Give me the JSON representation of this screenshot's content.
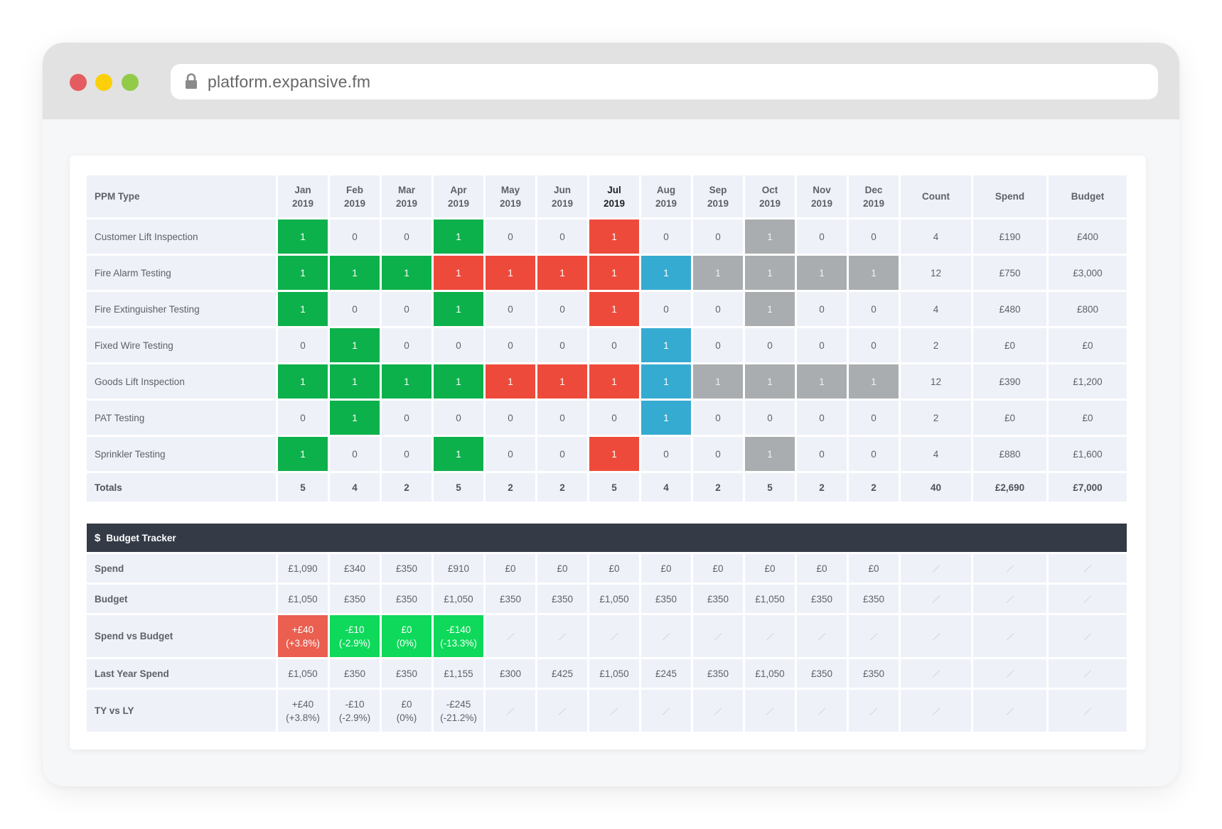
{
  "browser": {
    "url": "platform.expansive.fm",
    "lock_icon": "lock-icon",
    "window_controls": [
      "close",
      "minimize",
      "maximize"
    ]
  },
  "colors": {
    "completed": "#0db14b",
    "overdue": "#ee4a3b",
    "current": "#36abd1",
    "scheduled": "#a9adaf",
    "over_budget": "#ea5f50",
    "under_budget": "#0ed95a",
    "tracker_header": "#343a46"
  },
  "ppm": {
    "headers": {
      "type": "PPM Type",
      "months": [
        {
          "m": "Jan",
          "y": "2019"
        },
        {
          "m": "Feb",
          "y": "2019"
        },
        {
          "m": "Mar",
          "y": "2019"
        },
        {
          "m": "Apr",
          "y": "2019"
        },
        {
          "m": "May",
          "y": "2019"
        },
        {
          "m": "Jun",
          "y": "2019"
        },
        {
          "m": "Jul",
          "y": "2019",
          "current": true
        },
        {
          "m": "Aug",
          "y": "2019"
        },
        {
          "m": "Sep",
          "y": "2019"
        },
        {
          "m": "Oct",
          "y": "2019"
        },
        {
          "m": "Nov",
          "y": "2019"
        },
        {
          "m": "Dec",
          "y": "2019"
        }
      ],
      "count": "Count",
      "spend": "Spend",
      "budget": "Budget"
    },
    "rows": [
      {
        "name": "Customer Lift Inspection",
        "cells": [
          [
            "1",
            "g"
          ],
          [
            "0",
            ""
          ],
          [
            "0",
            ""
          ],
          [
            "1",
            "g"
          ],
          [
            "0",
            ""
          ],
          [
            "0",
            ""
          ],
          [
            "1",
            "r"
          ],
          [
            "0",
            ""
          ],
          [
            "0",
            ""
          ],
          [
            "1",
            "k"
          ],
          [
            "0",
            ""
          ],
          [
            "0",
            ""
          ]
        ],
        "count": "4",
        "spend": "£190",
        "budget": "£400"
      },
      {
        "name": "Fire Alarm Testing",
        "cells": [
          [
            "1",
            "g"
          ],
          [
            "1",
            "g"
          ],
          [
            "1",
            "g"
          ],
          [
            "1",
            "r"
          ],
          [
            "1",
            "r"
          ],
          [
            "1",
            "r"
          ],
          [
            "1",
            "r"
          ],
          [
            "1",
            "b"
          ],
          [
            "1",
            "k"
          ],
          [
            "1",
            "k"
          ],
          [
            "1",
            "k"
          ],
          [
            "1",
            "k"
          ]
        ],
        "count": "12",
        "spend": "£750",
        "budget": "£3,000"
      },
      {
        "name": "Fire Extinguisher Testing",
        "cells": [
          [
            "1",
            "g"
          ],
          [
            "0",
            ""
          ],
          [
            "0",
            ""
          ],
          [
            "1",
            "g"
          ],
          [
            "0",
            ""
          ],
          [
            "0",
            ""
          ],
          [
            "1",
            "r"
          ],
          [
            "0",
            ""
          ],
          [
            "0",
            ""
          ],
          [
            "1",
            "k"
          ],
          [
            "0",
            ""
          ],
          [
            "0",
            ""
          ]
        ],
        "count": "4",
        "spend": "£480",
        "budget": "£800"
      },
      {
        "name": "Fixed Wire Testing",
        "cells": [
          [
            "0",
            ""
          ],
          [
            "1",
            "g"
          ],
          [
            "0",
            ""
          ],
          [
            "0",
            ""
          ],
          [
            "0",
            ""
          ],
          [
            "0",
            ""
          ],
          [
            "0",
            ""
          ],
          [
            "1",
            "b"
          ],
          [
            "0",
            ""
          ],
          [
            "0",
            ""
          ],
          [
            "0",
            ""
          ],
          [
            "0",
            ""
          ]
        ],
        "count": "2",
        "spend": "£0",
        "budget": "£0"
      },
      {
        "name": "Goods Lift Inspection",
        "cells": [
          [
            "1",
            "g"
          ],
          [
            "1",
            "g"
          ],
          [
            "1",
            "g"
          ],
          [
            "1",
            "g"
          ],
          [
            "1",
            "r"
          ],
          [
            "1",
            "r"
          ],
          [
            "1",
            "r"
          ],
          [
            "1",
            "b"
          ],
          [
            "1",
            "k"
          ],
          [
            "1",
            "k"
          ],
          [
            "1",
            "k"
          ],
          [
            "1",
            "k"
          ]
        ],
        "count": "12",
        "spend": "£390",
        "budget": "£1,200"
      },
      {
        "name": "PAT Testing",
        "cells": [
          [
            "0",
            ""
          ],
          [
            "1",
            "g"
          ],
          [
            "0",
            ""
          ],
          [
            "0",
            ""
          ],
          [
            "0",
            ""
          ],
          [
            "0",
            ""
          ],
          [
            "0",
            ""
          ],
          [
            "1",
            "b"
          ],
          [
            "0",
            ""
          ],
          [
            "0",
            ""
          ],
          [
            "0",
            ""
          ],
          [
            "0",
            ""
          ]
        ],
        "count": "2",
        "spend": "£0",
        "budget": "£0"
      },
      {
        "name": "Sprinkler Testing",
        "cells": [
          [
            "1",
            "g"
          ],
          [
            "0",
            ""
          ],
          [
            "0",
            ""
          ],
          [
            "1",
            "g"
          ],
          [
            "0",
            ""
          ],
          [
            "0",
            ""
          ],
          [
            "1",
            "r"
          ],
          [
            "0",
            ""
          ],
          [
            "0",
            ""
          ],
          [
            "1",
            "k"
          ],
          [
            "0",
            ""
          ],
          [
            "0",
            ""
          ]
        ],
        "count": "4",
        "spend": "£880",
        "budget": "£1,600"
      }
    ],
    "totals": {
      "label": "Totals",
      "months": [
        "5",
        "4",
        "2",
        "5",
        "2",
        "2",
        "5",
        "4",
        "2",
        "5",
        "2",
        "2"
      ],
      "count": "40",
      "spend": "£2,690",
      "budget": "£7,000"
    }
  },
  "budget_tracker": {
    "title": "Budget Tracker",
    "icon": "dollar-icon",
    "rows": [
      {
        "label": "Spend",
        "tall": false,
        "cells": [
          [
            "£1,090",
            ""
          ],
          [
            "£340",
            ""
          ],
          [
            "£350",
            ""
          ],
          [
            "£910",
            ""
          ],
          [
            "£0",
            ""
          ],
          [
            "£0",
            ""
          ],
          [
            "£0",
            ""
          ],
          [
            "£0",
            ""
          ],
          [
            "£0",
            ""
          ],
          [
            "£0",
            ""
          ],
          [
            "£0",
            ""
          ],
          [
            "£0",
            ""
          ]
        ]
      },
      {
        "label": "Budget",
        "tall": false,
        "cells": [
          [
            "£1,050",
            ""
          ],
          [
            "£350",
            ""
          ],
          [
            "£350",
            ""
          ],
          [
            "£1,050",
            ""
          ],
          [
            "£350",
            ""
          ],
          [
            "£350",
            ""
          ],
          [
            "£1,050",
            ""
          ],
          [
            "£350",
            ""
          ],
          [
            "£350",
            ""
          ],
          [
            "£1,050",
            ""
          ],
          [
            "£350",
            ""
          ],
          [
            "£350",
            ""
          ]
        ]
      },
      {
        "label": "Spend vs Budget",
        "tall": true,
        "cells": [
          [
            "+£40\n(+3.8%)",
            "over"
          ],
          [
            "-£10\n(-2.9%)",
            "under"
          ],
          [
            "£0\n(0%)",
            "under"
          ],
          [
            "-£140\n(-13.3%)",
            "under"
          ],
          null,
          null,
          null,
          null,
          null,
          null,
          null,
          null
        ]
      },
      {
        "label": "Last Year Spend",
        "tall": false,
        "cells": [
          [
            "£1,050",
            ""
          ],
          [
            "£350",
            ""
          ],
          [
            "£350",
            ""
          ],
          [
            "£1,155",
            ""
          ],
          [
            "£300",
            ""
          ],
          [
            "£425",
            ""
          ],
          [
            "£1,050",
            ""
          ],
          [
            "£245",
            ""
          ],
          [
            "£350",
            ""
          ],
          [
            "£1,050",
            ""
          ],
          [
            "£350",
            ""
          ],
          [
            "£350",
            ""
          ]
        ]
      },
      {
        "label": "TY vs LY",
        "tall": true,
        "cells": [
          [
            "+£40\n(+3.8%)",
            ""
          ],
          [
            "-£10\n(-2.9%)",
            ""
          ],
          [
            "£0\n(0%)",
            ""
          ],
          [
            "-£245\n(-21.2%)",
            ""
          ],
          null,
          null,
          null,
          null,
          null,
          null,
          null,
          null
        ]
      }
    ]
  }
}
